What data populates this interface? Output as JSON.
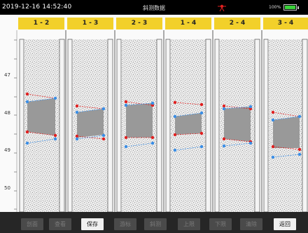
{
  "status_bar": {
    "datetime": "2019-12-16  14:52:40",
    "title": "斜测数据",
    "battery_percent": "100%",
    "signal_icon": "signal-strength-icon",
    "battery_icon": "battery-full-icon"
  },
  "ruler": {
    "labels": [
      "47",
      "48",
      "49",
      "50"
    ]
  },
  "tabs": [
    {
      "label": "1 - 2"
    },
    {
      "label": "1 - 3"
    },
    {
      "label": "2 - 3"
    },
    {
      "label": "1 - 4"
    },
    {
      "label": "2 - 4"
    },
    {
      "label": "3 - 4"
    }
  ],
  "colors": {
    "tab_bg": "#f2d02a",
    "red_marker": "#e02020",
    "blue_marker": "#3a8ee6",
    "zone_fill": "#999999"
  },
  "toolbar": {
    "buttons": [
      {
        "label": "剖面",
        "enabled": false
      },
      {
        "label": "查看",
        "enabled": false
      },
      {
        "label": "保存",
        "enabled": true
      },
      {
        "label": "游标",
        "enabled": false
      },
      {
        "label": "斜测",
        "enabled": false
      },
      {
        "label": "上限",
        "enabled": false
      },
      {
        "label": "下限",
        "enabled": false
      },
      {
        "label": "清除",
        "enabled": false
      },
      {
        "label": "返回",
        "enabled": true
      }
    ]
  }
}
